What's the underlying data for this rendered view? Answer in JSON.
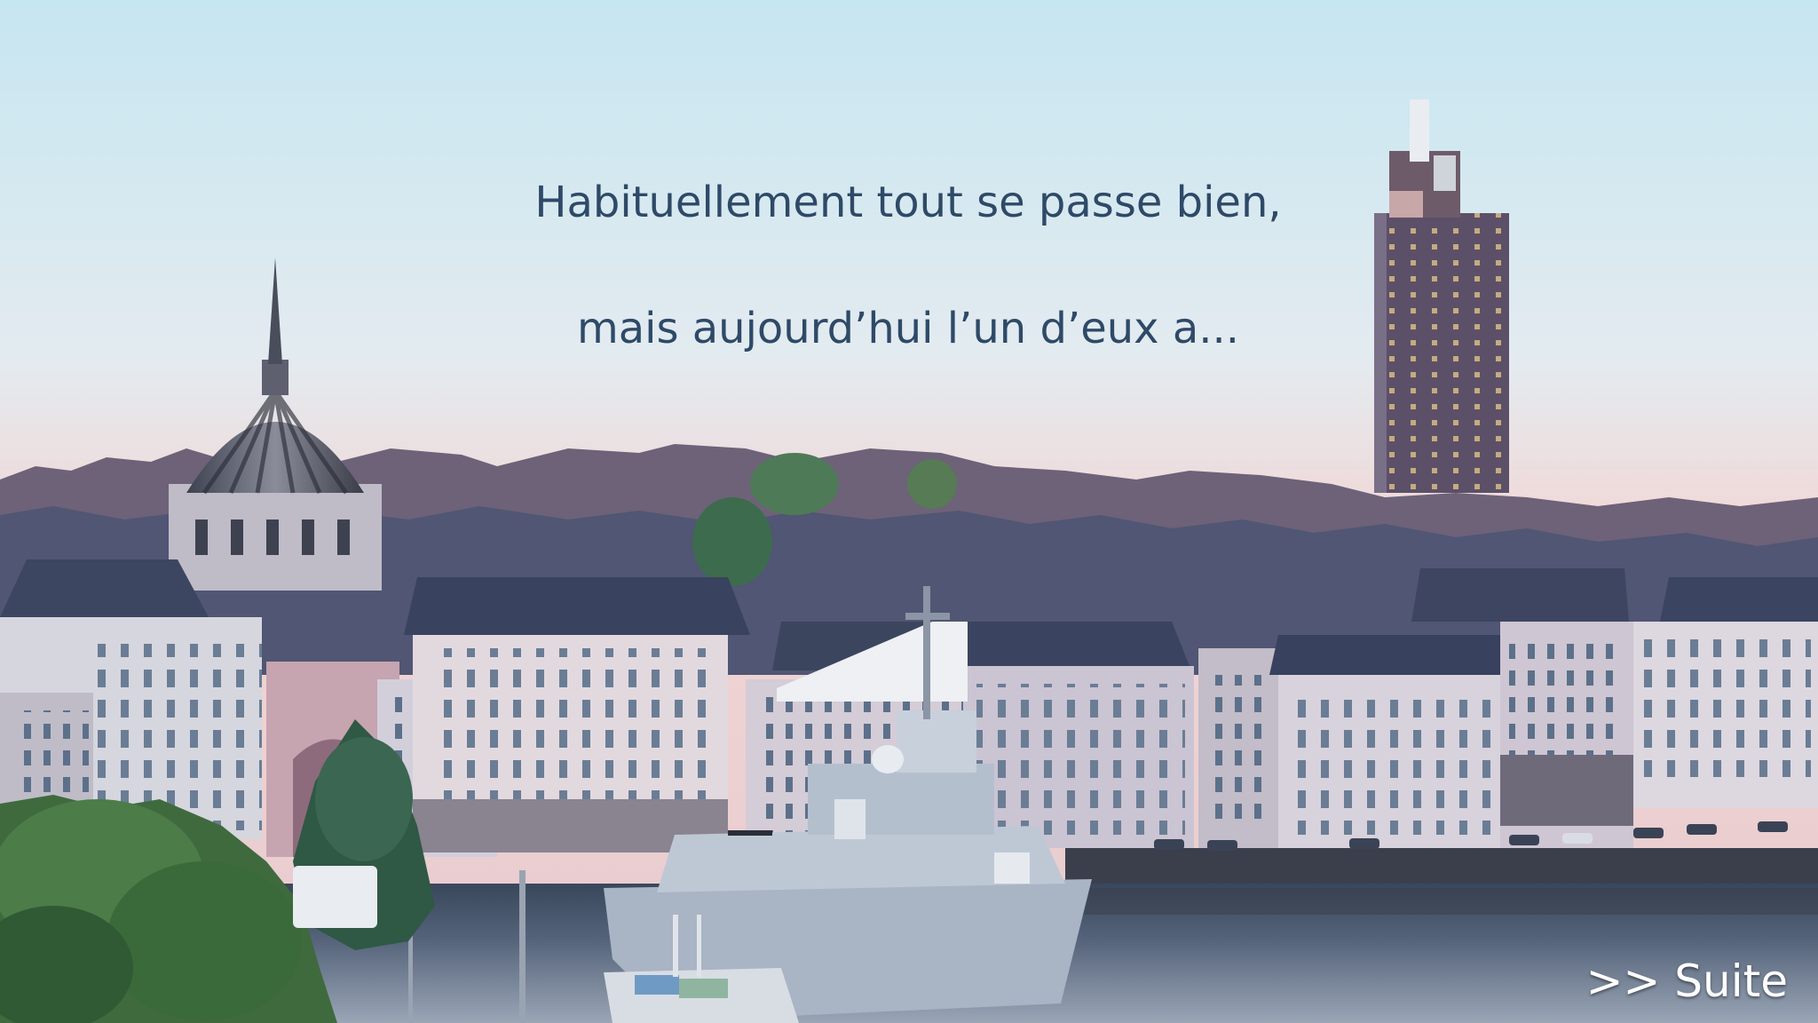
{
  "dialogue": {
    "line1": "Habituellement tout se passe bien,",
    "line2": "mais aujourd’hui l’un d’eux a..."
  },
  "controls": {
    "next_label": ">> Suite"
  },
  "colors": {
    "sky_top": "#c6e6f1",
    "sky_bottom": "#f2d7d6",
    "text": "#2e4a68",
    "water": "#4a5a72"
  }
}
